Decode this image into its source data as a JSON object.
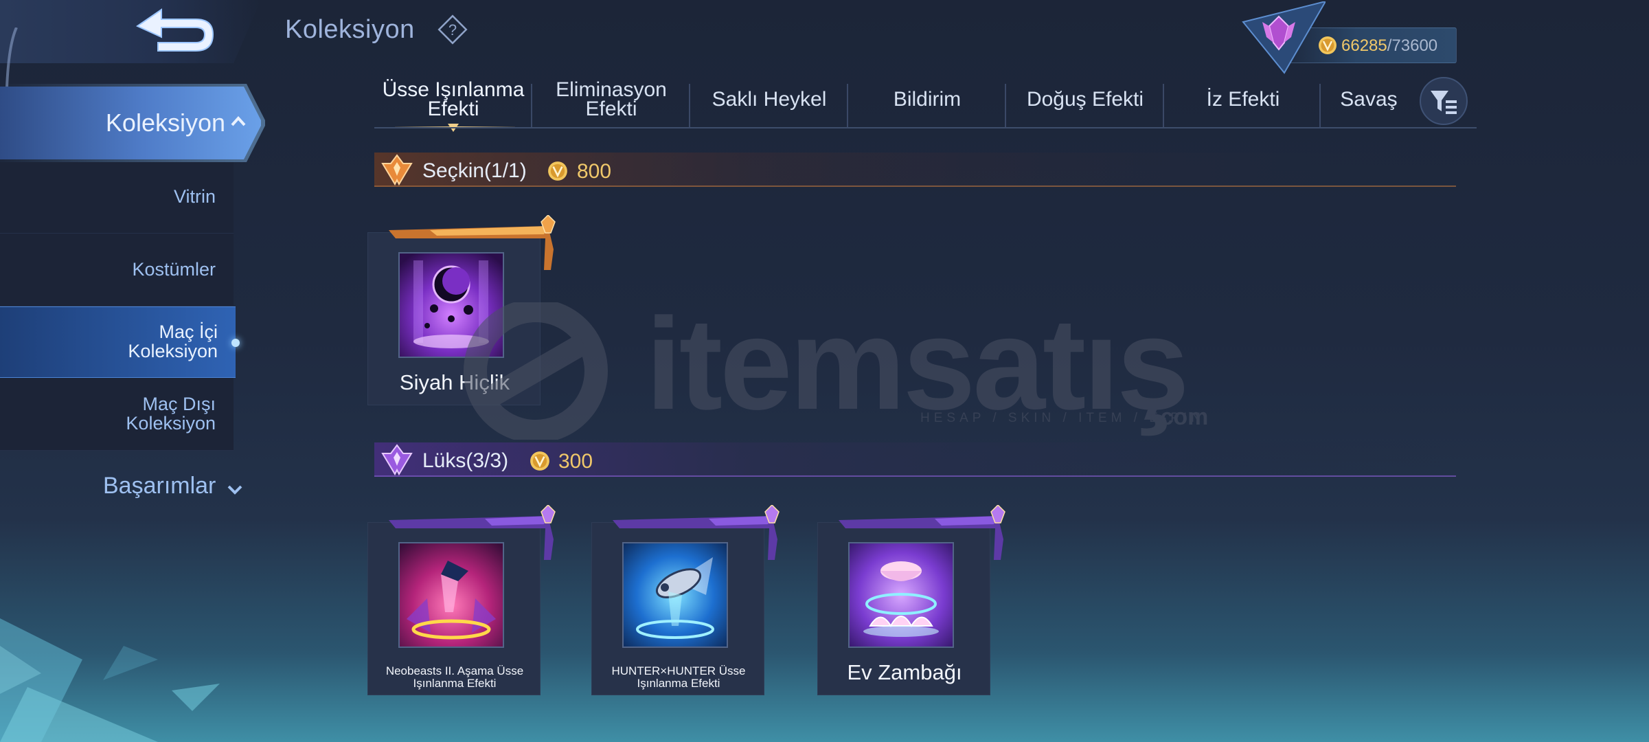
{
  "header": {
    "title": "Koleksiyon",
    "back_icon": "back-arrow-icon",
    "help_icon": "question-mark-icon"
  },
  "currency": {
    "current": "66285",
    "max": "/73600",
    "icon": "coin-icon"
  },
  "sidebar": {
    "main_label": "Koleksiyon",
    "items": [
      {
        "label": "Vitrin"
      },
      {
        "label": "Kostümler"
      },
      {
        "label": "Maç İçi Koleksiyon",
        "active": true
      },
      {
        "label": "Maç Dışı Koleksiyon"
      }
    ],
    "achievements_label": "Başarımlar"
  },
  "tabs": [
    {
      "label": "Üsse Işınlanma Efekti",
      "active": true
    },
    {
      "label": "Eliminasyon Efekti"
    },
    {
      "label": "Saklı Heykel"
    },
    {
      "label": "Bildirim"
    },
    {
      "label": "Doğuş Efekti"
    },
    {
      "label": "İz Efekti"
    },
    {
      "label": "Savaş"
    }
  ],
  "sections": [
    {
      "title": "Seçkin",
      "count": "(1/1)",
      "price": "800",
      "color": "#e08a3c",
      "items": [
        {
          "name": "Siyah Hiçlik"
        }
      ]
    },
    {
      "title": "Lüks",
      "count": "(3/3)",
      "price": "300",
      "color": "#8a5ad8",
      "items": [
        {
          "name": "Neobeasts II. Aşama Üsse Işınlanma Efekti"
        },
        {
          "name": "HUNTER×HUNTER Üsse Işınlanma Efekti"
        },
        {
          "name": "Ev Zambağı"
        }
      ]
    }
  ],
  "watermark": {
    "brand": "itemsatış",
    "tagline": "HESAP / SKIN / ITEM / E-PIN",
    "suffix": ".com"
  }
}
